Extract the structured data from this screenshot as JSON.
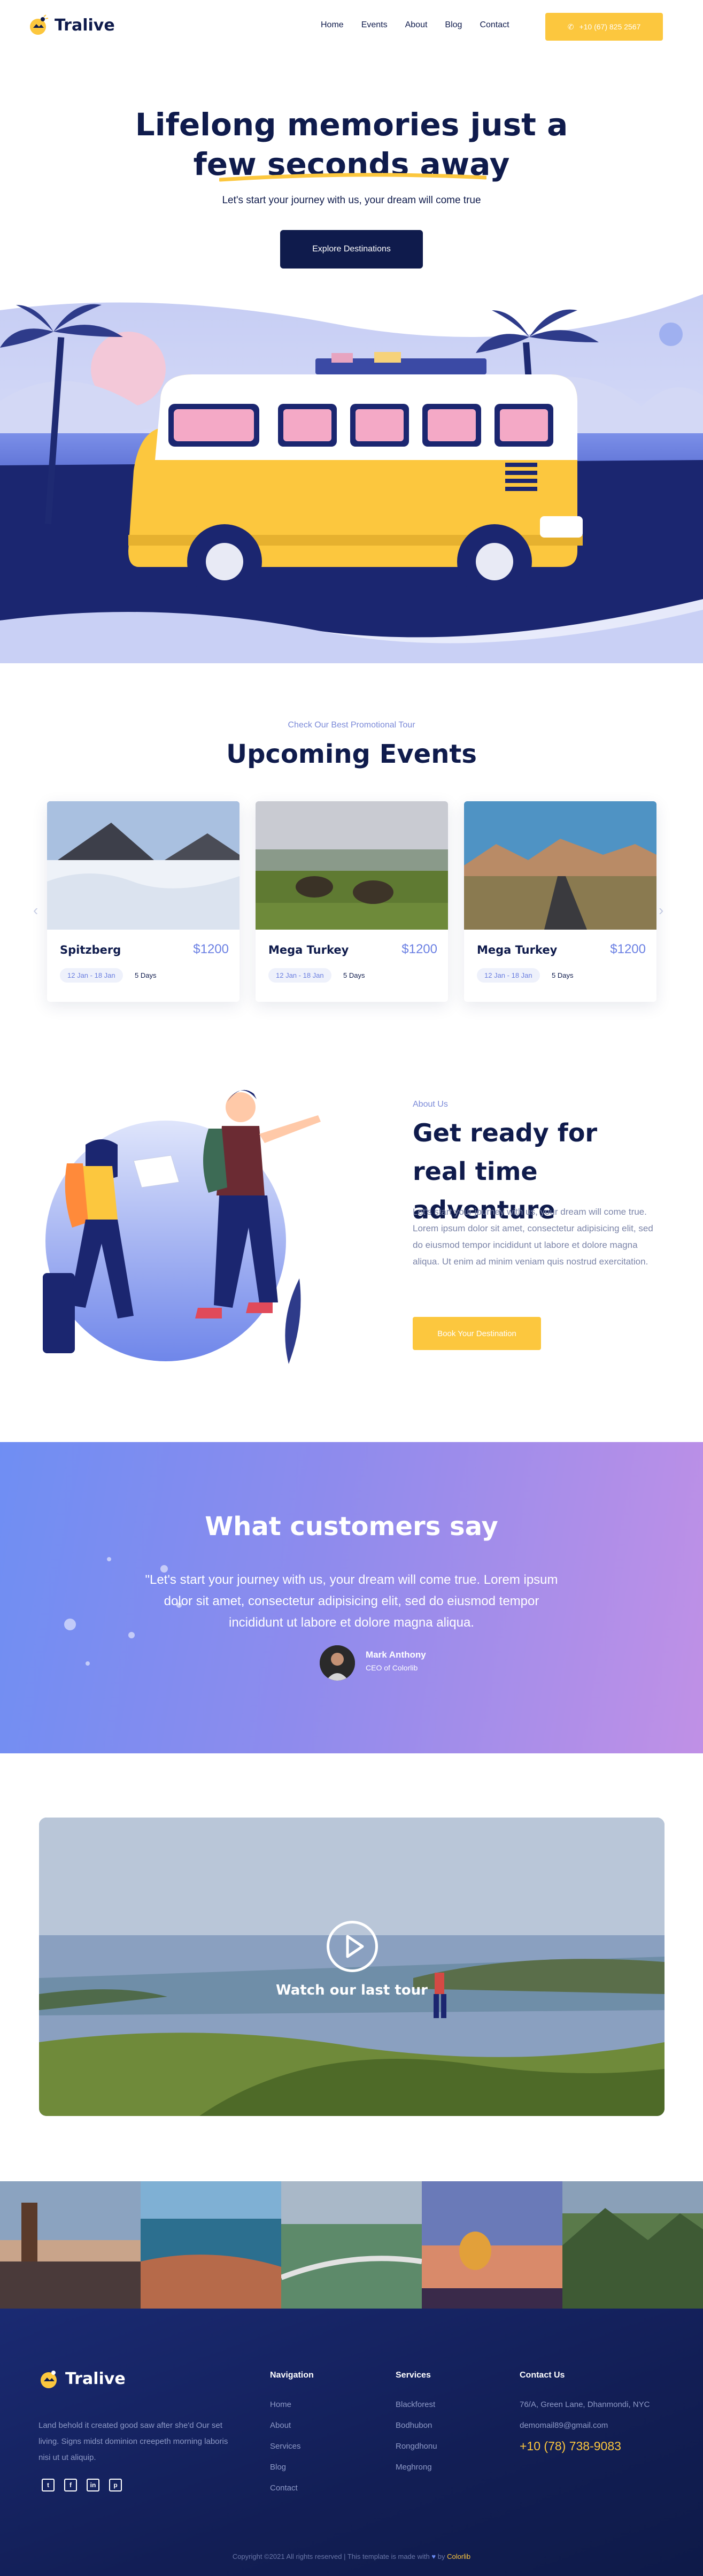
{
  "brand": {
    "name": "Tralive"
  },
  "nav": {
    "items": [
      "Home",
      "Events",
      "About",
      "Blog",
      "Contact"
    ]
  },
  "header": {
    "phone": "+10 (67) 825 2567"
  },
  "hero": {
    "title_line1": "Lifelong memories just a",
    "title_line2": "few seconds away",
    "subtitle": "Let's start your journey with us, your dream will come true",
    "button": "Explore Destinations"
  },
  "events": {
    "eyebrow": "Check Our Best Promotional Tour",
    "title": "Upcoming Events",
    "cards": [
      {
        "name": "Spitzberg",
        "price": "$1200",
        "date": "12 Jan - 18 Jan",
        "days": "5 Days"
      },
      {
        "name": "Mega Turkey",
        "price": "$1200",
        "date": "12 Jan - 18 Jan",
        "days": "5 Days"
      },
      {
        "name": "Mega Turkey",
        "price": "$1200",
        "date": "12 Jan - 18 Jan",
        "days": "5 Days"
      }
    ]
  },
  "about": {
    "eyebrow": "About Us",
    "title": "Get ready for real time adventure",
    "body": "Let's start your journey with us, your dream will come true. Lorem ipsum dolor sit amet, consectetur adipisicing elit, sed do eiusmod tempor incididunt ut labore et dolore magna aliqua. Ut enim ad minim veniam quis nostrud exercitation.",
    "button": "Book Your Destination"
  },
  "testimonial": {
    "title": "What customers say",
    "quote": "\"Let's start your journey with us, your dream will come true. Lorem ipsum dolor sit amet, consectetur adipisicing elit, sed do eiusmod tempor incididunt ut labore et dolore magna aliqua.",
    "name": "Mark Anthony",
    "role": "CEO of Colorlib"
  },
  "video": {
    "label": "Watch our last tour"
  },
  "footer": {
    "description": "Land behold it created good saw after she'd Our set living. Signs midst dominion creepeth morning laboris nisi ut ut aliquip.",
    "social": [
      "twitter-icon",
      "facebook-icon",
      "linkedin-icon",
      "pinterest-icon"
    ],
    "navigation": {
      "title": "Navigation",
      "items": [
        "Home",
        "About",
        "Services",
        "Blog",
        "Contact"
      ]
    },
    "services": {
      "title": "Services",
      "items": [
        "Blackforest",
        "Bodhubon",
        "Rongdhonu",
        "Meghrong"
      ]
    },
    "contact": {
      "title": "Contact Us",
      "address": "76/A, Green Lane, Dhanmondi, NYC",
      "email": "demomail89@gmail.com",
      "phone": "+10 (78) 738-9083"
    },
    "copyright_text": "Copyright ©2021 All rights reserved | This template is made with",
    "copyright_by": "by",
    "copyright_brand": "Colorlib"
  },
  "colors": {
    "navy": "#0f1b4c",
    "accent_yellow": "#fcc73e",
    "accent_blue": "#6b80e3"
  }
}
